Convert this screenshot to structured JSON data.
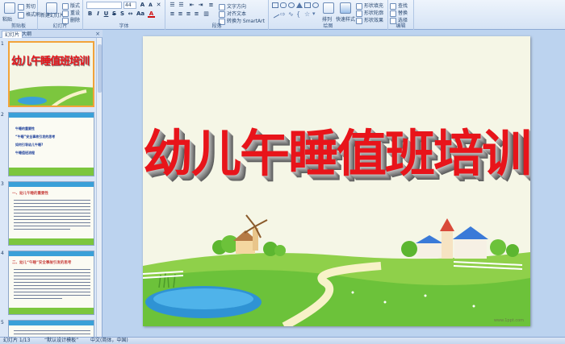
{
  "ribbon": {
    "groups": {
      "clipboard": "剪贴板",
      "slides": "幻灯片",
      "font": "字体",
      "paragraph": "段落",
      "drawing": "绘图",
      "editing": "编辑"
    },
    "paste": "粘贴",
    "cut": "剪切",
    "format_painter": "格式刷",
    "new_slide": "新建幻灯片",
    "layout": "版式",
    "reset": "重设",
    "delete": "删除",
    "font_size": "44",
    "text_direction": "文字方向",
    "align_text": "对齐文本",
    "convert_smartart": "转换为 SmartArt",
    "arrange": "排列",
    "quick_styles": "快速样式",
    "shape_fill": "形状填充",
    "shape_outline": "形状轮廓",
    "shape_effects": "形状效果",
    "find": "查找",
    "replace": "替换",
    "select": "选择"
  },
  "pane": {
    "tab_slides": "幻灯片",
    "tab_outline": "大纲",
    "close": "×",
    "thumbs": [
      {
        "num": "1",
        "title": "幼儿午睡值班培训"
      },
      {
        "num": "2",
        "items": [
          "午睡的重要性",
          "“午睡”安全事故引发的思考",
          "如何引导幼儿午睡?",
          "午睡值班流程"
        ]
      },
      {
        "num": "3",
        "heading": "一、幼儿午睡的重要性"
      },
      {
        "num": "4",
        "heading": "二、幼儿“午睡”安全事故引发的思考"
      },
      {
        "num": "5"
      }
    ]
  },
  "slide": {
    "title": "幼儿午睡值班培训",
    "watermark": "www.1ppt.com"
  },
  "status": {
    "slide_info": "幻灯片 1/13",
    "theme": "“默认设计模板”",
    "language": "中文(简体，中国)"
  },
  "colors": {
    "title_red": "#e8141a",
    "selection": "#f2a33a",
    "grass": "#6cc23a"
  }
}
